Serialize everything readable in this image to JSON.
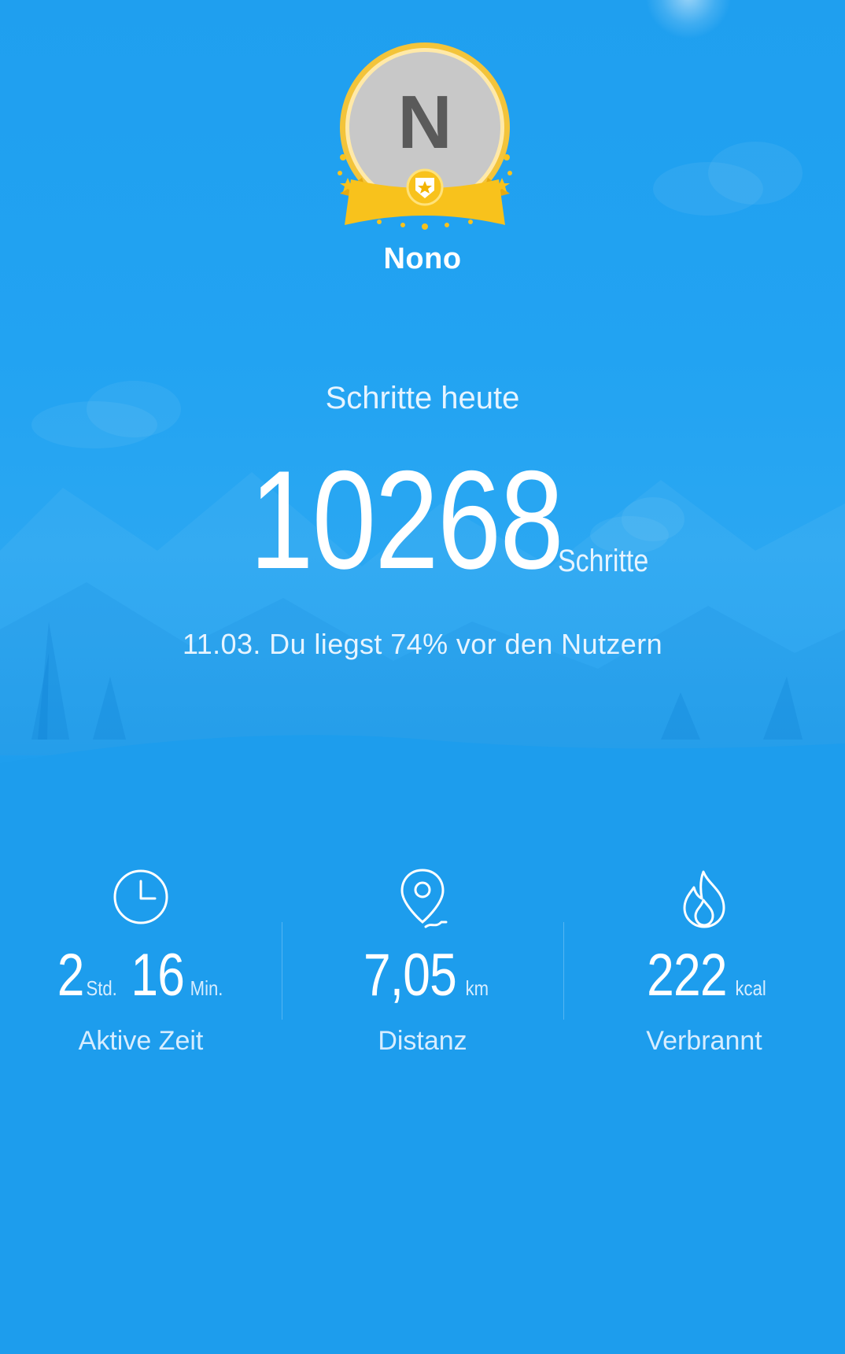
{
  "profile": {
    "avatar_initial": "N",
    "username": "Nono"
  },
  "steps": {
    "title": "Schritte heute",
    "value": "10268",
    "unit": "Schritte",
    "comparison": "11.03. Du liegst 74% vor den Nutzern"
  },
  "stats": {
    "active_time": {
      "hours": "2",
      "hours_unit": "Std.",
      "minutes": "16",
      "minutes_unit": "Min.",
      "label": "Aktive Zeit",
      "icon": "clock-icon"
    },
    "distance": {
      "value": "7,05",
      "unit": "km",
      "label": "Distanz",
      "icon": "location-pin-icon"
    },
    "calories": {
      "value": "222",
      "unit": "kcal",
      "label": "Verbrannt",
      "icon": "flame-icon"
    }
  },
  "colors": {
    "background": "#1d9ded",
    "badge_gold": "#f8c21c",
    "avatar_grey": "#c8c8c8"
  }
}
